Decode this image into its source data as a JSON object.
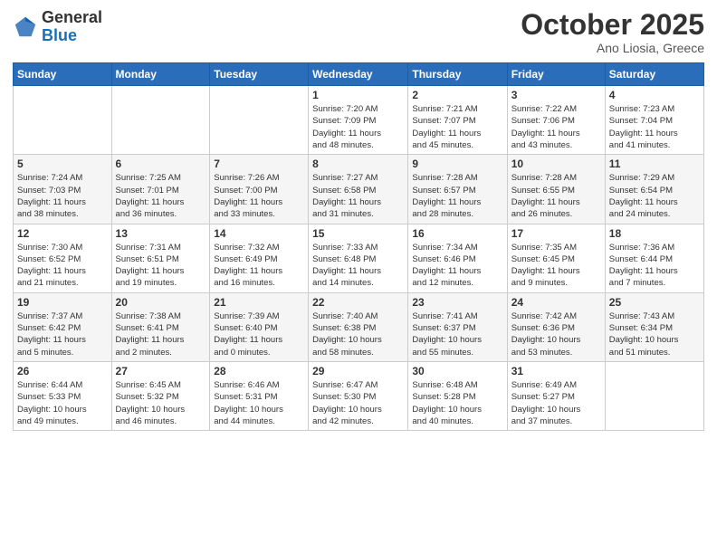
{
  "header": {
    "logo_general": "General",
    "logo_blue": "Blue",
    "month": "October 2025",
    "location": "Ano Liosia, Greece"
  },
  "weekdays": [
    "Sunday",
    "Monday",
    "Tuesday",
    "Wednesday",
    "Thursday",
    "Friday",
    "Saturday"
  ],
  "weeks": [
    [
      {
        "day": "",
        "info": ""
      },
      {
        "day": "",
        "info": ""
      },
      {
        "day": "",
        "info": ""
      },
      {
        "day": "1",
        "info": "Sunrise: 7:20 AM\nSunset: 7:09 PM\nDaylight: 11 hours\nand 48 minutes."
      },
      {
        "day": "2",
        "info": "Sunrise: 7:21 AM\nSunset: 7:07 PM\nDaylight: 11 hours\nand 45 minutes."
      },
      {
        "day": "3",
        "info": "Sunrise: 7:22 AM\nSunset: 7:06 PM\nDaylight: 11 hours\nand 43 minutes."
      },
      {
        "day": "4",
        "info": "Sunrise: 7:23 AM\nSunset: 7:04 PM\nDaylight: 11 hours\nand 41 minutes."
      }
    ],
    [
      {
        "day": "5",
        "info": "Sunrise: 7:24 AM\nSunset: 7:03 PM\nDaylight: 11 hours\nand 38 minutes."
      },
      {
        "day": "6",
        "info": "Sunrise: 7:25 AM\nSunset: 7:01 PM\nDaylight: 11 hours\nand 36 minutes."
      },
      {
        "day": "7",
        "info": "Sunrise: 7:26 AM\nSunset: 7:00 PM\nDaylight: 11 hours\nand 33 minutes."
      },
      {
        "day": "8",
        "info": "Sunrise: 7:27 AM\nSunset: 6:58 PM\nDaylight: 11 hours\nand 31 minutes."
      },
      {
        "day": "9",
        "info": "Sunrise: 7:28 AM\nSunset: 6:57 PM\nDaylight: 11 hours\nand 28 minutes."
      },
      {
        "day": "10",
        "info": "Sunrise: 7:28 AM\nSunset: 6:55 PM\nDaylight: 11 hours\nand 26 minutes."
      },
      {
        "day": "11",
        "info": "Sunrise: 7:29 AM\nSunset: 6:54 PM\nDaylight: 11 hours\nand 24 minutes."
      }
    ],
    [
      {
        "day": "12",
        "info": "Sunrise: 7:30 AM\nSunset: 6:52 PM\nDaylight: 11 hours\nand 21 minutes."
      },
      {
        "day": "13",
        "info": "Sunrise: 7:31 AM\nSunset: 6:51 PM\nDaylight: 11 hours\nand 19 minutes."
      },
      {
        "day": "14",
        "info": "Sunrise: 7:32 AM\nSunset: 6:49 PM\nDaylight: 11 hours\nand 16 minutes."
      },
      {
        "day": "15",
        "info": "Sunrise: 7:33 AM\nSunset: 6:48 PM\nDaylight: 11 hours\nand 14 minutes."
      },
      {
        "day": "16",
        "info": "Sunrise: 7:34 AM\nSunset: 6:46 PM\nDaylight: 11 hours\nand 12 minutes."
      },
      {
        "day": "17",
        "info": "Sunrise: 7:35 AM\nSunset: 6:45 PM\nDaylight: 11 hours\nand 9 minutes."
      },
      {
        "day": "18",
        "info": "Sunrise: 7:36 AM\nSunset: 6:44 PM\nDaylight: 11 hours\nand 7 minutes."
      }
    ],
    [
      {
        "day": "19",
        "info": "Sunrise: 7:37 AM\nSunset: 6:42 PM\nDaylight: 11 hours\nand 5 minutes."
      },
      {
        "day": "20",
        "info": "Sunrise: 7:38 AM\nSunset: 6:41 PM\nDaylight: 11 hours\nand 2 minutes."
      },
      {
        "day": "21",
        "info": "Sunrise: 7:39 AM\nSunset: 6:40 PM\nDaylight: 11 hours\nand 0 minutes."
      },
      {
        "day": "22",
        "info": "Sunrise: 7:40 AM\nSunset: 6:38 PM\nDaylight: 10 hours\nand 58 minutes."
      },
      {
        "day": "23",
        "info": "Sunrise: 7:41 AM\nSunset: 6:37 PM\nDaylight: 10 hours\nand 55 minutes."
      },
      {
        "day": "24",
        "info": "Sunrise: 7:42 AM\nSunset: 6:36 PM\nDaylight: 10 hours\nand 53 minutes."
      },
      {
        "day": "25",
        "info": "Sunrise: 7:43 AM\nSunset: 6:34 PM\nDaylight: 10 hours\nand 51 minutes."
      }
    ],
    [
      {
        "day": "26",
        "info": "Sunrise: 6:44 AM\nSunset: 5:33 PM\nDaylight: 10 hours\nand 49 minutes."
      },
      {
        "day": "27",
        "info": "Sunrise: 6:45 AM\nSunset: 5:32 PM\nDaylight: 10 hours\nand 46 minutes."
      },
      {
        "day": "28",
        "info": "Sunrise: 6:46 AM\nSunset: 5:31 PM\nDaylight: 10 hours\nand 44 minutes."
      },
      {
        "day": "29",
        "info": "Sunrise: 6:47 AM\nSunset: 5:30 PM\nDaylight: 10 hours\nand 42 minutes."
      },
      {
        "day": "30",
        "info": "Sunrise: 6:48 AM\nSunset: 5:28 PM\nDaylight: 10 hours\nand 40 minutes."
      },
      {
        "day": "31",
        "info": "Sunrise: 6:49 AM\nSunset: 5:27 PM\nDaylight: 10 hours\nand 37 minutes."
      },
      {
        "day": "",
        "info": ""
      }
    ]
  ]
}
